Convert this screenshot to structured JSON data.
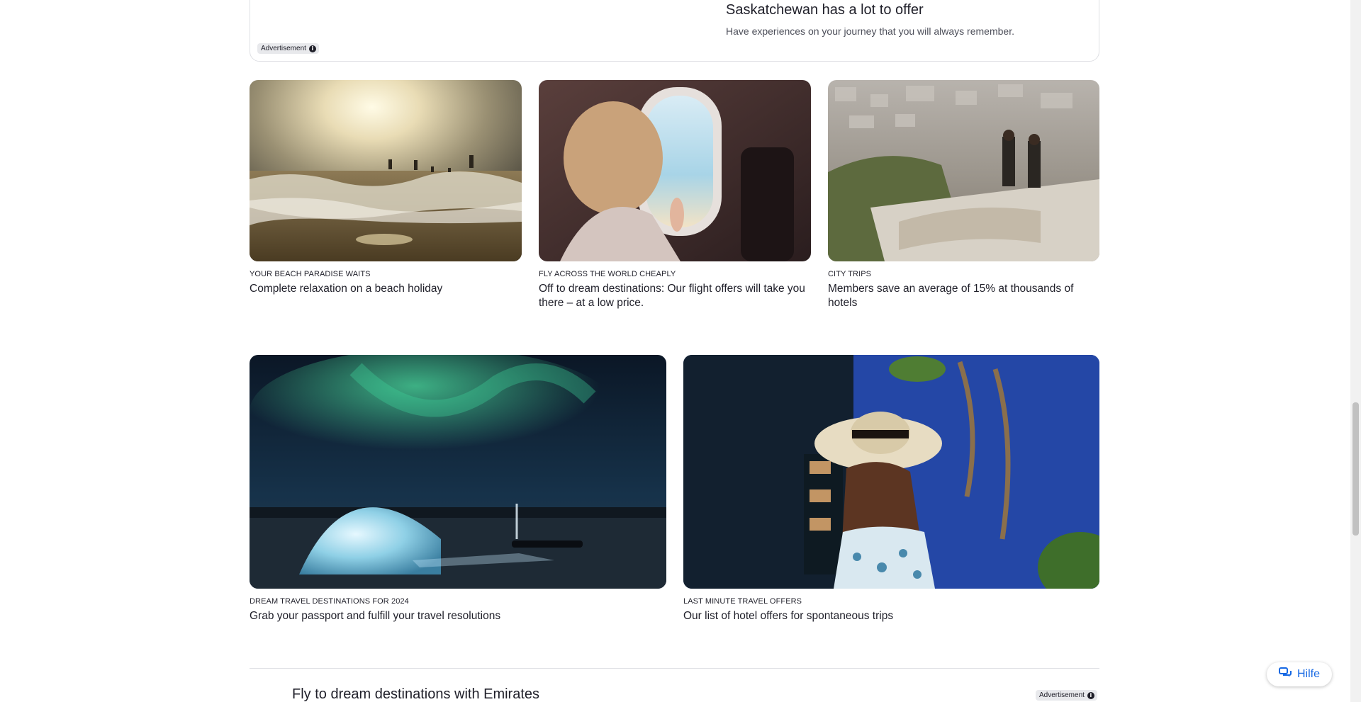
{
  "ad_card": {
    "title": "Saskatchewan has a lot to offer",
    "subtitle": "Have experiences on your journey that you will always remember.",
    "badge": "Advertisement",
    "info_glyph": "i"
  },
  "cards": [
    {
      "eyebrow": "YOUR BEACH PARADISE WAITS",
      "headline": "Complete relaxation on a beach holiday",
      "image_icon": "beach-waves-image"
    },
    {
      "eyebrow": "FLY ACROSS THE WORLD CHEAPLY",
      "headline": "Off to dream destinations: Our flight offers will take you there – at a low price.",
      "image_icon": "airplane-window-image"
    },
    {
      "eyebrow": "CITY TRIPS",
      "headline": "Members save an average of 15% at thousands of hotels",
      "image_icon": "city-view-image"
    },
    {
      "eyebrow": "DREAM TRAVEL DESTINATIONS FOR 2024",
      "headline": "Grab your passport and fulfill your travel resolutions",
      "image_icon": "aurora-igloo-image"
    },
    {
      "eyebrow": "LAST MINUTE TRAVEL OFFERS",
      "headline": "Our list of hotel offers for spontaneous trips",
      "image_icon": "woman-sunhat-image"
    }
  ],
  "bottom_section": {
    "title": "Fly to dream destinations with Emirates",
    "badge": "Advertisement"
  },
  "help": {
    "label": "Hilfe",
    "icon": "chat-icon"
  },
  "colors": {
    "accent": "#1668e3",
    "text": "#1f1f29",
    "border": "#dfe0e4"
  }
}
